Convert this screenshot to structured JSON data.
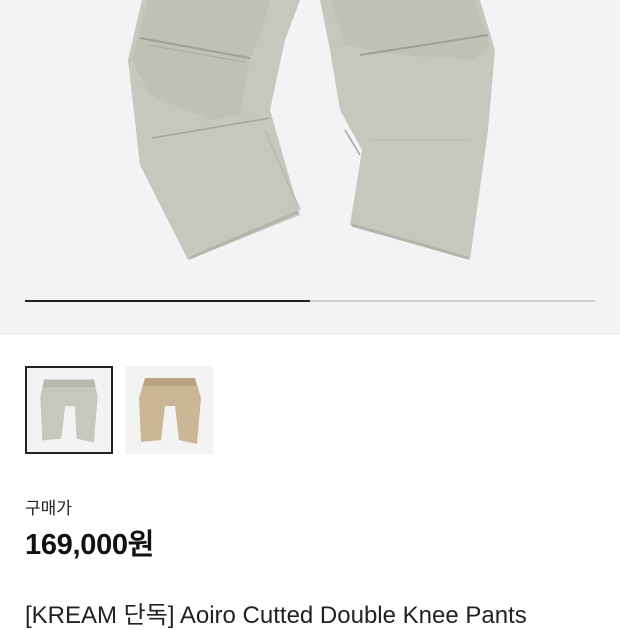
{
  "product": {
    "gallery": {
      "active_index": 0,
      "total": 2,
      "progress": 0.5
    },
    "thumbnails": [
      {
        "name": "sage",
        "color": "#c6c8bd",
        "selected": true
      },
      {
        "name": "beige",
        "color": "#cbb796",
        "selected": false
      }
    ],
    "price_label": "구매가",
    "price": "169,000원",
    "title": "[KREAM 단독] Aoiro Cutted Double Knee Pants"
  },
  "colors": {
    "hero_bg": "#f3f3f3",
    "pants_main": "#c6c8bd"
  }
}
